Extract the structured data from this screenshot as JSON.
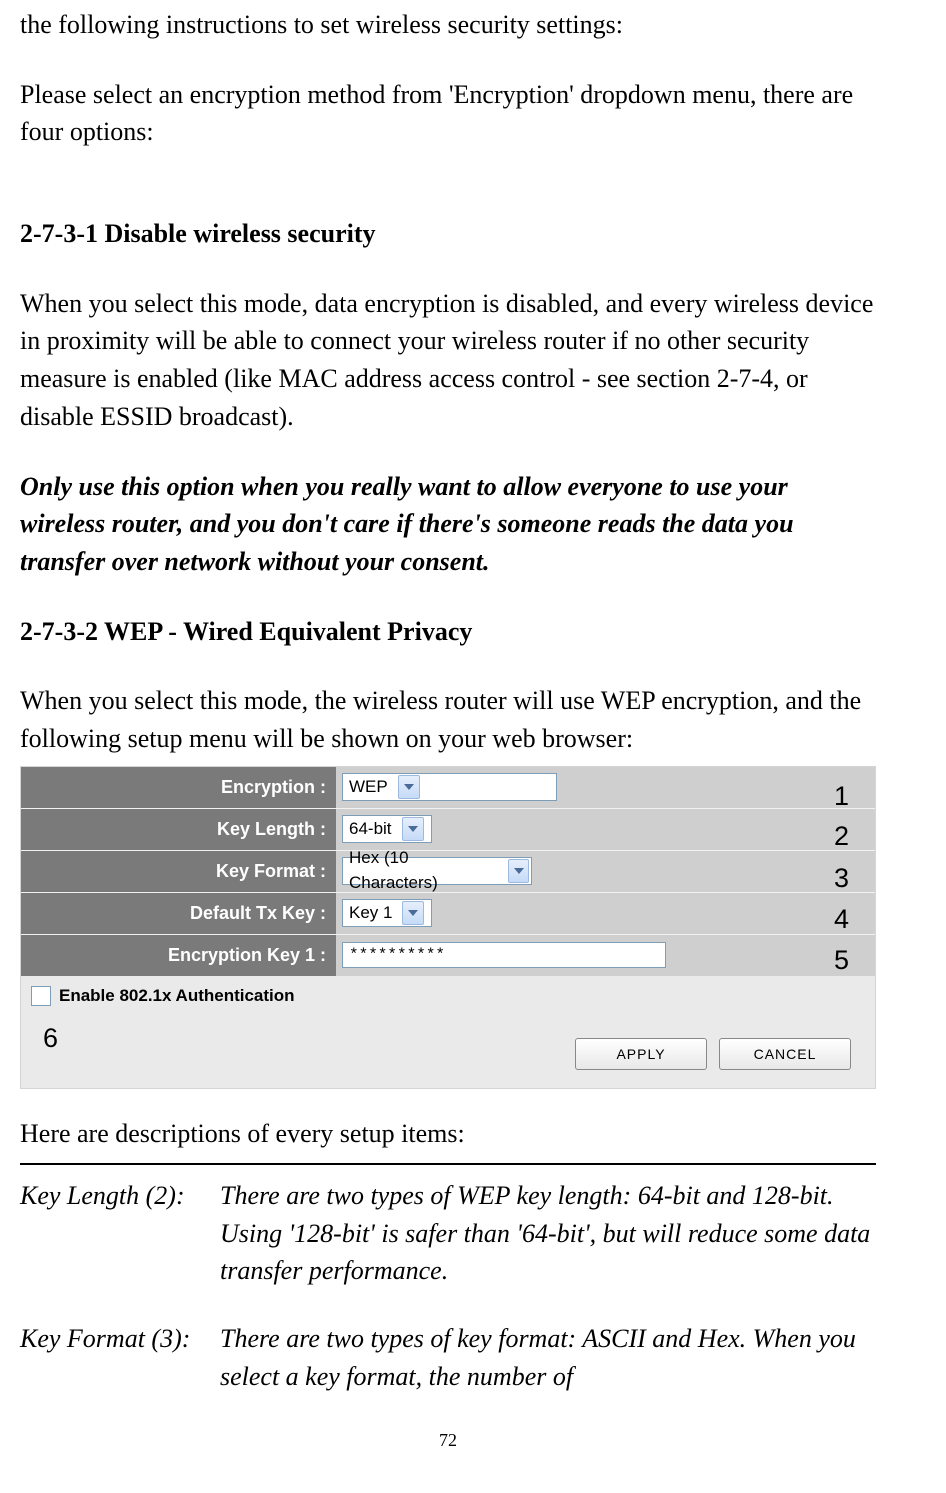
{
  "body": {
    "intro1": "the following instructions to set wireless security settings:",
    "intro2": "Please select an encryption method from 'Encryption' dropdown menu, there are four options:",
    "h1": "2-7-3-1 Disable wireless security",
    "p1": "When you select this mode, data encryption is disabled, and every wireless device in proximity will be able to connect your wireless router if no other security measure is enabled (like MAC address access control - see section 2-7-4, or disable ESSID broadcast).",
    "warning": "Only use this option when you really want to allow everyone to use your wireless router, and you don't care if there's someone reads the data you transfer over network without your consent.",
    "h2": "2-7-3-2 WEP - Wired Equivalent Privacy",
    "p2": "When you select this mode, the wireless router will use WEP encryption, and the following setup menu will be shown on your web browser:",
    "descIntro": "Here are descriptions of every setup items:"
  },
  "shot": {
    "rows": {
      "encryption": {
        "label": "Encryption :",
        "value": "WEP"
      },
      "keyLength": {
        "label": "Key Length :",
        "value": "64-bit"
      },
      "keyFormat": {
        "label": "Key Format :",
        "value": "Hex (10 Characters)"
      },
      "defaultTx": {
        "label": "Default Tx Key :",
        "value": "Key 1"
      },
      "encKey1": {
        "label": "Encryption Key 1 :",
        "value": "**********"
      }
    },
    "checkbox": "Enable 802.1x Authentication",
    "apply": "APPLY",
    "cancel": "CANCEL",
    "tags": {
      "n1": "1",
      "n2": "2",
      "n3": "3",
      "n4": "4",
      "n5": "5",
      "n6": "6"
    }
  },
  "descriptions": {
    "keyLength": {
      "term": "Key Length (2):",
      "text": "There are two types of WEP key length: 64-bit and 128-bit. Using '128-bit' is safer than '64-bit', but will reduce some data transfer performance."
    },
    "keyFormat": {
      "term": "Key Format (3):",
      "text": "There are two types of key format: ASCII and Hex. When you select a key format, the number of"
    }
  },
  "pageNumber": "72"
}
